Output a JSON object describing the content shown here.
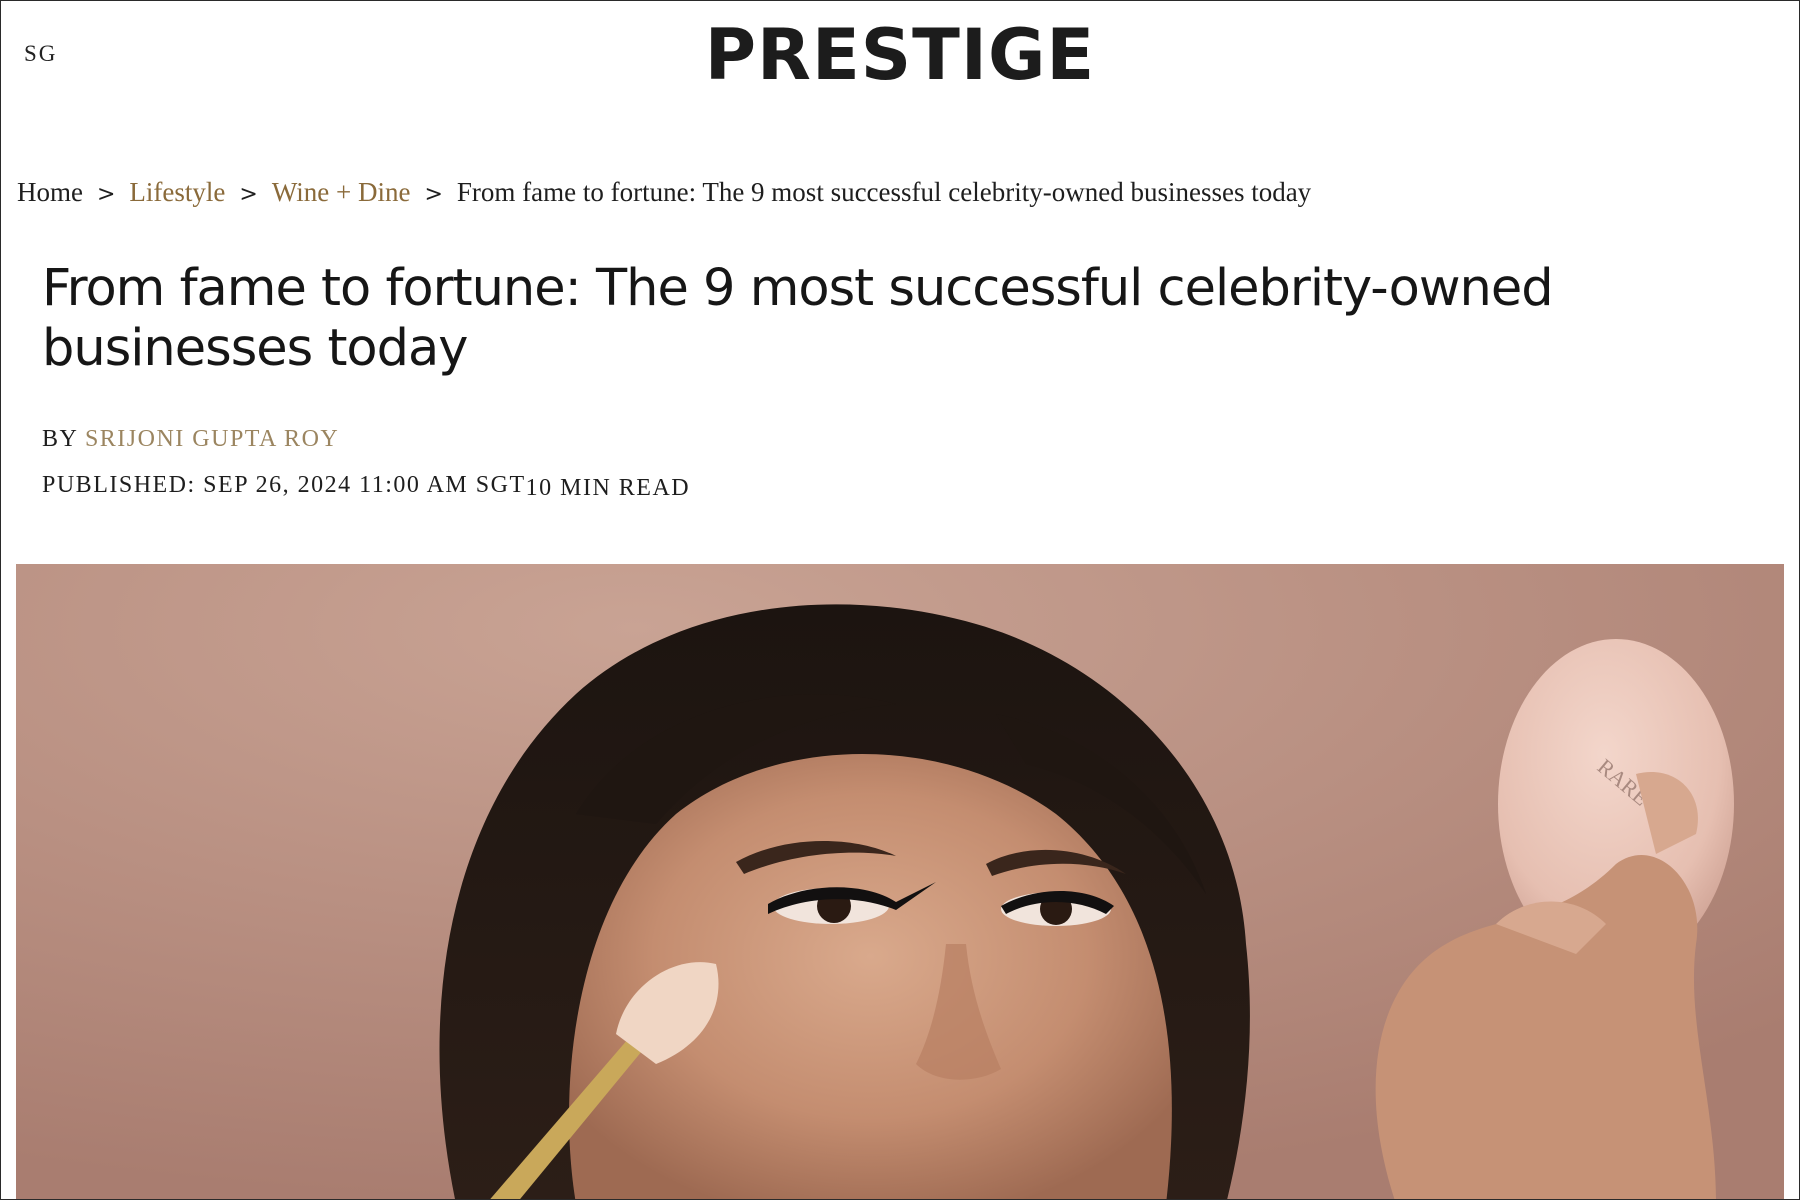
{
  "header": {
    "region": "SG",
    "logo_text": "PRESTIGE"
  },
  "breadcrumb": {
    "items": [
      "Home",
      "Lifestyle",
      "Wine + Dine",
      "From fame to fortune: The 9 most successful celebrity-owned businesses today"
    ],
    "separator": ">"
  },
  "article": {
    "title": "From fame to fortune: The 9 most successful celebrity-owned businesses today",
    "by_label": "BY",
    "author": "SRIJONI GUPTA ROY",
    "published": "PUBLISHED: SEP 26, 2024 11:00 AM SGT",
    "read_time": "10 MIN READ"
  },
  "hero_image": {
    "compact_text": "RARE"
  },
  "colors": {
    "link": "#8a6a3a",
    "author": "#9b8560",
    "hero_background": "#b68c7d"
  }
}
